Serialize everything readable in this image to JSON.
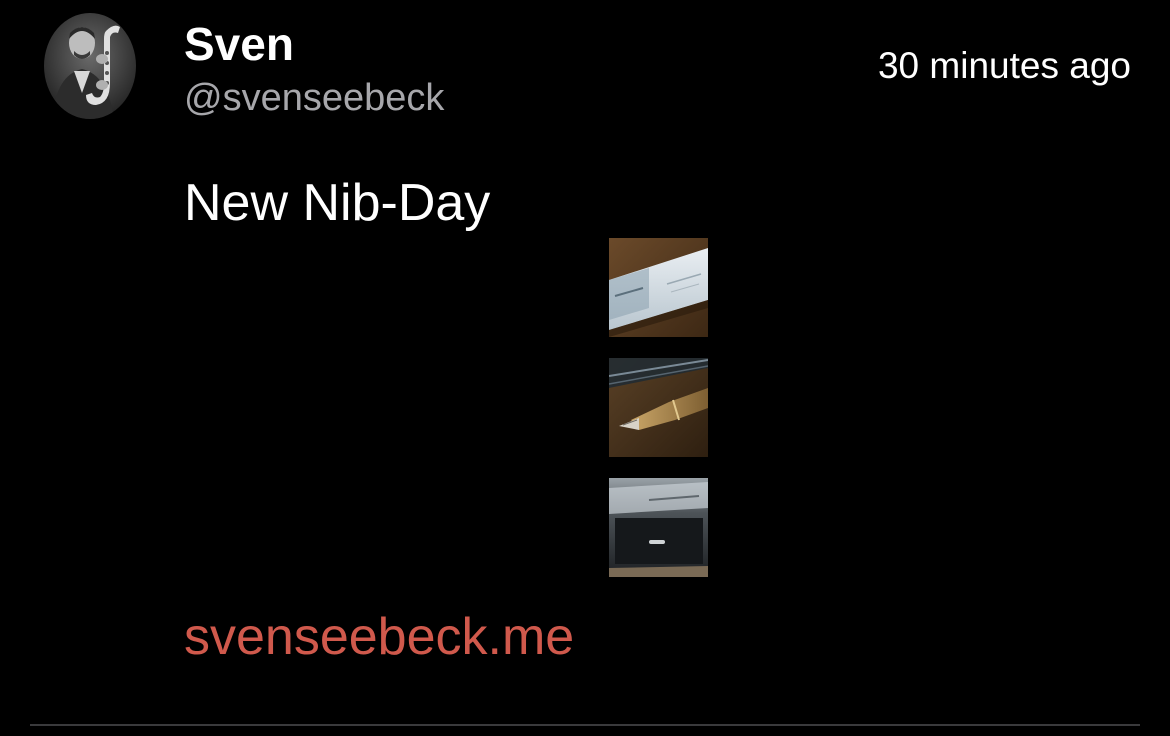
{
  "author": {
    "display_name": "Sven",
    "handle": "@svenseebeck",
    "avatar_icon": "saxophone-player-portrait"
  },
  "timestamp": "30 minutes ago",
  "post": {
    "text": "New Nib-Day",
    "link_text": "svenseebeck.me",
    "attachments": [
      {
        "icon": "pen-box-photo"
      },
      {
        "icon": "fountain-pen-nib-photo"
      },
      {
        "icon": "pen-case-photo"
      }
    ]
  },
  "colors": {
    "background": "#000000",
    "primary_text": "#ffffff",
    "secondary_text": "#a7a7ab",
    "link": "#d0594c",
    "divider": "#3a3a3c"
  }
}
